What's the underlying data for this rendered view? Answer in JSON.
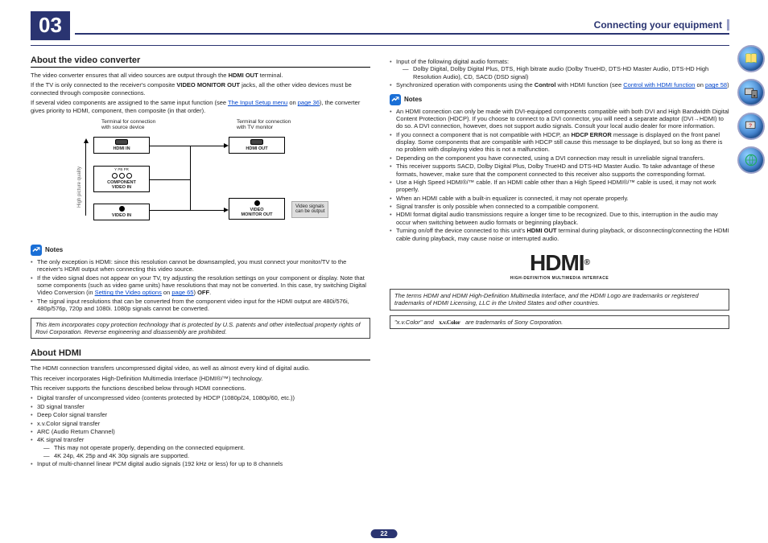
{
  "header": {
    "chapter": "03",
    "title": "Connecting your equipment"
  },
  "left": {
    "h1": "About the video converter",
    "p1a": "The video converter ensures that all video sources are output through the ",
    "p1b": "HDMI OUT",
    "p1c": " terminal.",
    "p2a": "If the TV is only connected to the receiver's composite ",
    "p2b": "VIDEO MONITOR OUT",
    "p2c": " jacks, all the other video devices must be connected through composite connections.",
    "p3a": "If several video components are assigned to the same input function (see ",
    "p3link": "The Input Setup menu",
    "p3b": " on ",
    "p3page": "page 36",
    "p3c": "), the converter gives priority to HDMI, component, then composite (in that order).",
    "diagram": {
      "termSrc": "Terminal for connection\nwith source device",
      "termTv": "Terminal for connection\nwith TV monitor",
      "hdmiIn": "HDMI IN",
      "compIn": "COMPONENT\nVIDEO IN",
      "ypr": "Y   PB   PR",
      "videoIn": "VIDEO IN",
      "hdmiOut": "HDMI OUT",
      "monOut": "VIDEO\nMONITOR OUT",
      "quality": "High picture quality",
      "gray": "Video signals\ncan be output"
    },
    "notesLabel": "Notes",
    "n1": "The only exception is HDMI: since this resolution cannot be downsampled, you must connect your monitor/TV to the receiver's HDMI output when connecting this video source.",
    "n2a": "If the video signal does not appear on your TV, try adjusting the resolution settings on your component or display. Note that some components (such as video game units) have resolutions that may not be converted. In this case, try switching Digital Video Conversion (in ",
    "n2link": "Setting the Video options",
    "n2b": " on ",
    "n2page": "page 65",
    "n2c": ") ",
    "n2off": "OFF",
    "n2d": ".",
    "n3": "The signal input resolutions that can be converted from the component video input for the HDMI output are 480i/576i, 480p/576p, 720p and 1080i. 1080p signals cannot be converted.",
    "framed1": "This item incorporates copy protection technology that is protected by U.S. patents and other intellectual property rights of Rovi Corporation. Reverse engineering and disassembly are prohibited.",
    "h2": "About HDMI",
    "hp1": "The HDMI connection transfers uncompressed digital video, as well as almost every kind of digital audio.",
    "hp2": "This receiver incorporates High-Definition Multimedia Interface (HDMI®/™) technology.",
    "hp3": "This receiver supports the functions described below through HDMI connections.",
    "hb1": "Digital transfer of uncompressed video (contents protected by HDCP (1080p/24, 1080p/60, etc.))",
    "hb2": "3D signal transfer",
    "hb3": "Deep Color signal transfer",
    "hb4": "x.v.Color signal transfer",
    "hb5": "ARC (Audio Return Channel)",
    "hb6": "4K signal transfer",
    "hb6s1": "This may not operate properly, depending on the connected equipment.",
    "hb6s2": "4K 24p, 4K 25p and 4K 30p signals are supported.",
    "hb7": "Input of multi-channel linear PCM digital audio signals (192 kHz or less) for up to 8 channels"
  },
  "right": {
    "rb1": "Input of the following digital audio formats:",
    "rb1s1": "Dolby Digital, Dolby Digital Plus, DTS, High bitrate audio (Dolby TrueHD, DTS-HD Master Audio, DTS-HD High Resolution Audio), CD, SACD (DSD signal)",
    "rb2a": "Synchronized operation with components using the ",
    "rb2b": "Control",
    "rb2c": " with HDMI function (see ",
    "rb2link": "Control with HDMI function",
    "rb2d": " on ",
    "rb2page": "page 58",
    "rb2e": ")",
    "notesLabel": "Notes",
    "nn1": "An HDMI connection can only be made with DVI-equipped components compatible with both DVI and High Bandwidth Digital Content Protection (HDCP). If you choose to connect to a DVI connector, you will need a separate adaptor (DVI→HDMI) to do so. A DVI connection, however, does not support audio signals. Consult your local audio dealer for more information.",
    "nn2a": "If you connect a component that is not compatible with HDCP, an ",
    "nn2b": "HDCP ERROR",
    "nn2c": " message is displayed on the front panel display. Some components that are compatible with HDCP still cause this message to be displayed, but so long as there is no problem with displaying video this is not a malfunction.",
    "nn3": "Depending on the component you have connected, using a DVI connection may result in unreliable signal transfers.",
    "nn4": "This receiver supports SACD, Dolby Digital Plus, Dolby TrueHD and DTS-HD Master Audio. To take advantage of these formats, however, make sure that the component connected to this receiver also supports the corresponding format.",
    "nn5": "Use a High Speed HDMI®/™ cable. If an HDMI cable other than a High Speed HDMI®/™ cable is used, it may not work properly.",
    "nn6": "When an HDMI cable with a built-in equalizer is connected, it may not operate properly.",
    "nn7": "Signal transfer is only possible when connected to a compatible component.",
    "nn8": "HDMI format digital audio transmissions require a longer time to be recognized. Due to this, interruption in the audio may occur when switching between audio formats or beginning playback.",
    "nn9a": "Turning on/off the device connected to this unit's ",
    "nn9b": "HDMI OUT",
    "nn9c": " terminal during playback, or disconnecting/connecting the HDMI cable during playback, may cause noise or interrupted audio.",
    "logoSub": "HIGH-DEFINITION MULTIMEDIA INTERFACE",
    "framed2": "The terms HDMI and HDMI High-Definition Multimedia Interface, and the HDMI Logo are trademarks or registered trademarks of HDMI Licensing, LLC in the United States and other countries.",
    "framed3a": "\"x.v.Color\" and ",
    "framed3b": " are trademarks of Sony Corporation.",
    "xv": "x.v.Color"
  },
  "pageNum": "22"
}
